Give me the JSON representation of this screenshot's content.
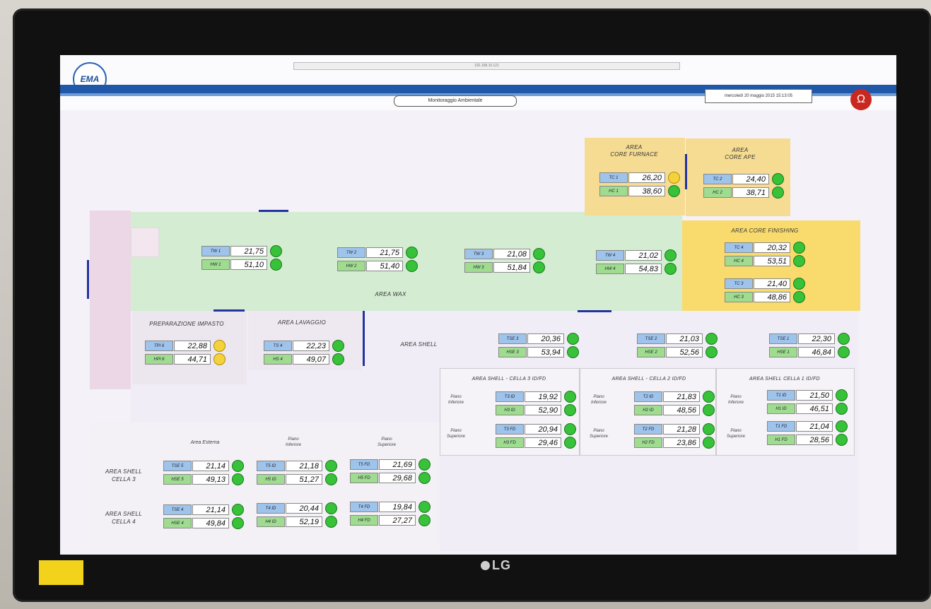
{
  "header": {
    "logo_text": "EMA",
    "top_hint": "192.168.10.121",
    "title": "Monitoraggio Ambientale",
    "datetime": "mercoledì 20 maggio 2015 15:13:05",
    "colors": {
      "header_blue": "#1f58a8",
      "ok_led": "#37c23a",
      "warn_led": "#f4d33a"
    }
  },
  "monitor_brand": "LG",
  "areas": {
    "wax": "AREA WAX",
    "core_furnace": "AREA\nCORE FURNACE",
    "core_ape": "AREA\nCORE APE",
    "core_finishing": "AREA CORE FINISHING",
    "prep": "PREPARAZIONE IMPASTO",
    "lavaggio": "AREA LAVAGGIO",
    "shell": "AREA SHELL",
    "cella3": "AREA SHELL - CELLA 3 ID/FD",
    "cella2": "AREA SHELL - CELLA 2 ID/FD",
    "cella1": "AREA SHELL CELLA 1 ID/FD",
    "ext_label": "Area Esterna",
    "piano_inf": "Piano\nInferiore",
    "piano_sup": "Piano\nSuperiore",
    "row_cella3": "AREA SHELL\nCELLA 3",
    "row_cella4": "AREA SHELL\nCELLA 4"
  },
  "sensors": {
    "tc1": {
      "t_tag": "TC 1",
      "t": "26,20",
      "h_tag": "HC 1",
      "h": "38,60",
      "t_status": "yellow",
      "h_status": "green"
    },
    "tc2": {
      "t_tag": "TC 2",
      "t": "24,40",
      "h_tag": "HC 2",
      "h": "38,71",
      "t_status": "green",
      "h_status": "green"
    },
    "tc4": {
      "t_tag": "TC 4",
      "t": "20,32",
      "h_tag": "HC 4",
      "h": "53,51",
      "t_status": "green",
      "h_status": "green"
    },
    "tc3": {
      "t_tag": "TC 3",
      "t": "21,40",
      "h_tag": "HC 3",
      "h": "48,86",
      "t_status": "green",
      "h_status": "green"
    },
    "tw1": {
      "t_tag": "TW 1",
      "t": "21,75",
      "h_tag": "HW 1",
      "h": "51,10",
      "t_status": "green",
      "h_status": "green"
    },
    "tw2": {
      "t_tag": "TW 2",
      "t": "21,75",
      "h_tag": "HW 2",
      "h": "51,40",
      "t_status": "green",
      "h_status": "green"
    },
    "tw3": {
      "t_tag": "TW 3",
      "t": "21,08",
      "h_tag": "HW 3",
      "h": "51,84",
      "t_status": "green",
      "h_status": "green"
    },
    "tw4": {
      "t_tag": "TW 4",
      "t": "21,02",
      "h_tag": "HW 4",
      "h": "54,83",
      "t_status": "green",
      "h_status": "green"
    },
    "tpi": {
      "t_tag": "TPI 6",
      "t": "22,88",
      "h_tag": "HPI 6",
      "h": "44,71",
      "t_status": "yellow",
      "h_status": "yellow"
    },
    "ts4": {
      "t_tag": "TS 4",
      "t": "22,23",
      "h_tag": "HS 4",
      "h": "49,07",
      "t_status": "green",
      "h_status": "green"
    },
    "tse3": {
      "t_tag": "TSE 3",
      "t": "20,36",
      "h_tag": "HSE 3",
      "h": "53,94",
      "t_status": "green",
      "h_status": "green"
    },
    "tse2": {
      "t_tag": "TSE 2",
      "t": "21,03",
      "h_tag": "HSE 2",
      "h": "52,56",
      "t_status": "green",
      "h_status": "green"
    },
    "tse1": {
      "t_tag": "TSE 1",
      "t": "22,30",
      "h_tag": "HSE 1",
      "h": "46,84",
      "t_status": "green",
      "h_status": "green"
    },
    "t3id": {
      "t_tag": "T3 ID",
      "t": "19,92",
      "h_tag": "H3 ID",
      "h": "52,90",
      "t_status": "green",
      "h_status": "green"
    },
    "t3fd": {
      "t_tag": "T3 FD",
      "t": "20,94",
      "h_tag": "H3 FD",
      "h": "29,46",
      "t_status": "green",
      "h_status": "green"
    },
    "t2id": {
      "t_tag": "T2 ID",
      "t": "21,83",
      "h_tag": "H2 ID",
      "h": "48,56",
      "t_status": "green",
      "h_status": "green"
    },
    "t2fd": {
      "t_tag": "T2 FD",
      "t": "21,28",
      "h_tag": "H2 FD",
      "h": "23,86",
      "t_status": "green",
      "h_status": "green"
    },
    "t1id": {
      "t_tag": "T1 ID",
      "t": "21,50",
      "h_tag": "H1 ID",
      "h": "46,51",
      "t_status": "green",
      "h_status": "green"
    },
    "t1fd": {
      "t_tag": "T1 FD",
      "t": "21,04",
      "h_tag": "H1 FD",
      "h": "28,56",
      "t_status": "green",
      "h_status": "green"
    },
    "tse5": {
      "t_tag": "TSE 5",
      "t": "21,14",
      "h_tag": "HSE 5",
      "h": "49,13",
      "t_status": "green",
      "h_status": "green"
    },
    "t5id": {
      "t_tag": "T5 ID",
      "t": "21,18",
      "h_tag": "H5 ID",
      "h": "51,27",
      "t_status": "green",
      "h_status": "green"
    },
    "t5fd": {
      "t_tag": "T5 FD",
      "t": "21,69",
      "h_tag": "H5 FD",
      "h": "29,68",
      "t_status": "green",
      "h_status": "green"
    },
    "tse4": {
      "t_tag": "TSE 4",
      "t": "21,14",
      "h_tag": "HSE 4",
      "h": "49,84",
      "t_status": "green",
      "h_status": "green"
    },
    "t4id": {
      "t_tag": "T4 ID",
      "t": "20,44",
      "h_tag": "H4 ID",
      "h": "52,19",
      "t_status": "green",
      "h_status": "green"
    },
    "t4fd": {
      "t_tag": "T4 FD",
      "t": "19,84",
      "h_tag": "H4 FD",
      "h": "27,27",
      "t_status": "green",
      "h_status": "green"
    }
  }
}
